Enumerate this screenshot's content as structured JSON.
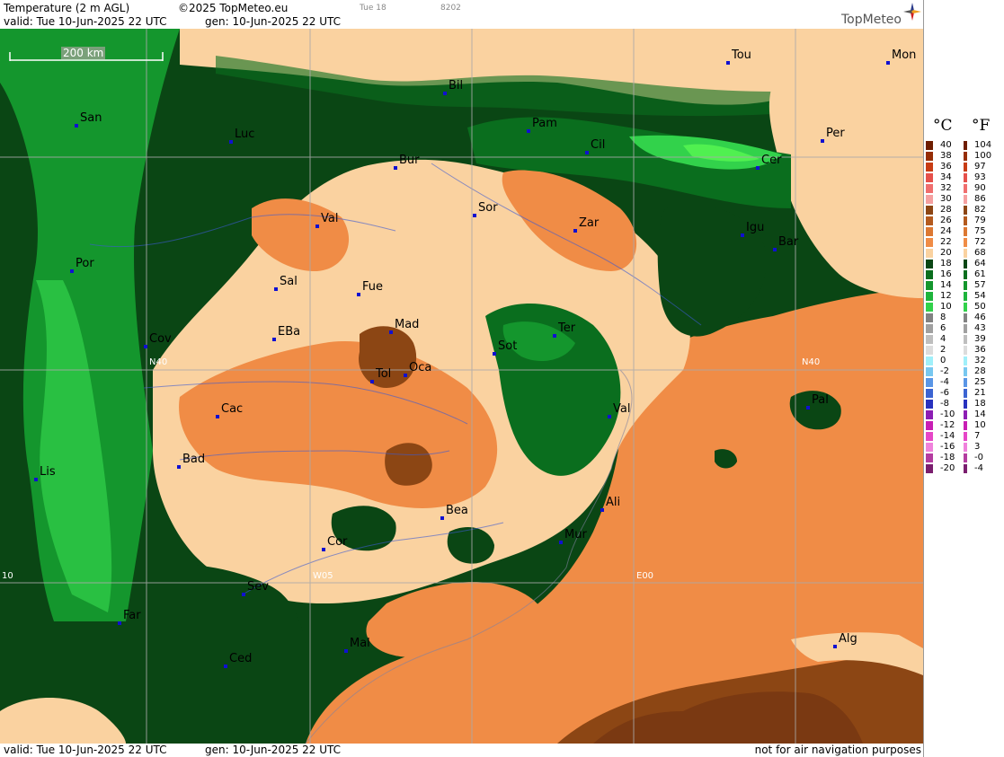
{
  "header": {
    "title": "Temperature (2 m AGL)",
    "copyright": "©2025 TopMeteo.eu",
    "run": "Tue 18",
    "code": "8202",
    "valid": "valid:  Tue  10-Jun-2025  22 UTC",
    "gen": "gen: 10-Jun-2025 22 UTC",
    "logo": "TopMeteo"
  },
  "footer": {
    "valid": "valid:  Tue  10-Jun-2025  22 UTC",
    "gen": "gen: 10-Jun-2025 22 UTC",
    "disclaimer": "not for air navigation purposes"
  },
  "map": {
    "scale_label": "200 km",
    "grid_labels": {
      "n40_left": "N40",
      "n40_right": "N40",
      "w05": "W05",
      "e00": "E00",
      "w10": "10"
    },
    "cities": [
      {
        "id": "san",
        "name": "San"
      },
      {
        "id": "luc",
        "name": "Luc"
      },
      {
        "id": "bil",
        "name": "Bil"
      },
      {
        "id": "tou",
        "name": "Tou"
      },
      {
        "id": "mon",
        "name": "Mon"
      },
      {
        "id": "pam",
        "name": "Pam"
      },
      {
        "id": "cil",
        "name": "Cil"
      },
      {
        "id": "per",
        "name": "Per"
      },
      {
        "id": "bur",
        "name": "Bur"
      },
      {
        "id": "cer",
        "name": "Cer"
      },
      {
        "id": "val1",
        "name": "Val"
      },
      {
        "id": "sor",
        "name": "Sor"
      },
      {
        "id": "zar",
        "name": "Zar"
      },
      {
        "id": "igu",
        "name": "Igu"
      },
      {
        "id": "bar",
        "name": "Bar"
      },
      {
        "id": "por",
        "name": "Por"
      },
      {
        "id": "sal",
        "name": "Sal"
      },
      {
        "id": "fue",
        "name": "Fue"
      },
      {
        "id": "mad",
        "name": "Mad"
      },
      {
        "id": "cov",
        "name": "Cov"
      },
      {
        "id": "eba",
        "name": "EBa"
      },
      {
        "id": "sot",
        "name": "Sot"
      },
      {
        "id": "ter",
        "name": "Ter"
      },
      {
        "id": "tol",
        "name": "Tol"
      },
      {
        "id": "oca",
        "name": "Oca"
      },
      {
        "id": "cac",
        "name": "Cac"
      },
      {
        "id": "val2",
        "name": "Val"
      },
      {
        "id": "pal",
        "name": "Pal"
      },
      {
        "id": "bad",
        "name": "Bad"
      },
      {
        "id": "lis",
        "name": "Lis"
      },
      {
        "id": "ali",
        "name": "Ali"
      },
      {
        "id": "bea",
        "name": "Bea"
      },
      {
        "id": "mur",
        "name": "Mur"
      },
      {
        "id": "cor",
        "name": "Cor"
      },
      {
        "id": "sev",
        "name": "Sev"
      },
      {
        "id": "far",
        "name": "Far"
      },
      {
        "id": "mal",
        "name": "Mal"
      },
      {
        "id": "ced",
        "name": "Ced"
      },
      {
        "id": "alg",
        "name": "Alg"
      }
    ]
  },
  "legend": {
    "celsius_label": "°C",
    "fahrenheit_label": "°F",
    "celsius": [
      "40",
      "38",
      "36",
      "34",
      "32",
      "30",
      "28",
      "26",
      "24",
      "22",
      "20",
      "18",
      "16",
      "14",
      "12",
      "10",
      "8",
      "6",
      "4",
      "2",
      "0",
      "-2",
      "-4",
      "-6",
      "-8",
      "-10",
      "-12",
      "-14",
      "-16",
      "-18",
      "-20"
    ],
    "fahrenheit": [
      "104",
      "100",
      "97",
      "93",
      "90",
      "86",
      "82",
      "79",
      "75",
      "72",
      "68",
      "64",
      "61",
      "57",
      "54",
      "50",
      "46",
      "43",
      "39",
      "36",
      "32",
      "28",
      "25",
      "21",
      "18",
      "14",
      "10",
      "7",
      "3",
      "-0",
      "-4"
    ],
    "colors": [
      "#6e1d00",
      "#962d05",
      "#c83c14",
      "#e6504b",
      "#f06e6e",
      "#f5a0a0",
      "#8c4614",
      "#b45a1e",
      "#dc7832",
      "#f08c46",
      "#fad2a0",
      "#0a4614",
      "#0a6e1e",
      "#14962d",
      "#1eb43c",
      "#32d24b",
      "#828282",
      "#a0a0a0",
      "#bebebe",
      "#dcdcdc",
      "#a0f0fa",
      "#78c8f0",
      "#5a96e6",
      "#3c64d2",
      "#2832be",
      "#8c1eb4",
      "#c81eb4",
      "#e646c8",
      "#f082dc",
      "#b43ca0",
      "#7a1e6e"
    ],
    "colors_f": [
      "#6e1d00",
      "#962d05",
      "#c83c14",
      "#e6504b",
      "#f06e6e",
      "#f5a0a0",
      "#8c4614",
      "#b45a1e",
      "#dc7832",
      "#f08c46",
      "#fad2a0",
      "#0a4614",
      "#0a6e1e",
      "#14962d",
      "#1eb43c",
      "#32d24b",
      "#828282",
      "#a0a0a0",
      "#bebebe",
      "#dcdcdc",
      "#a0f0fa",
      "#78c8f0",
      "#5a96e6",
      "#3c64d2",
      "#2832be",
      "#8c1eb4",
      "#c81eb4",
      "#e646c8",
      "#f082dc",
      "#b43ca0",
      "#7a1e6e"
    ]
  }
}
